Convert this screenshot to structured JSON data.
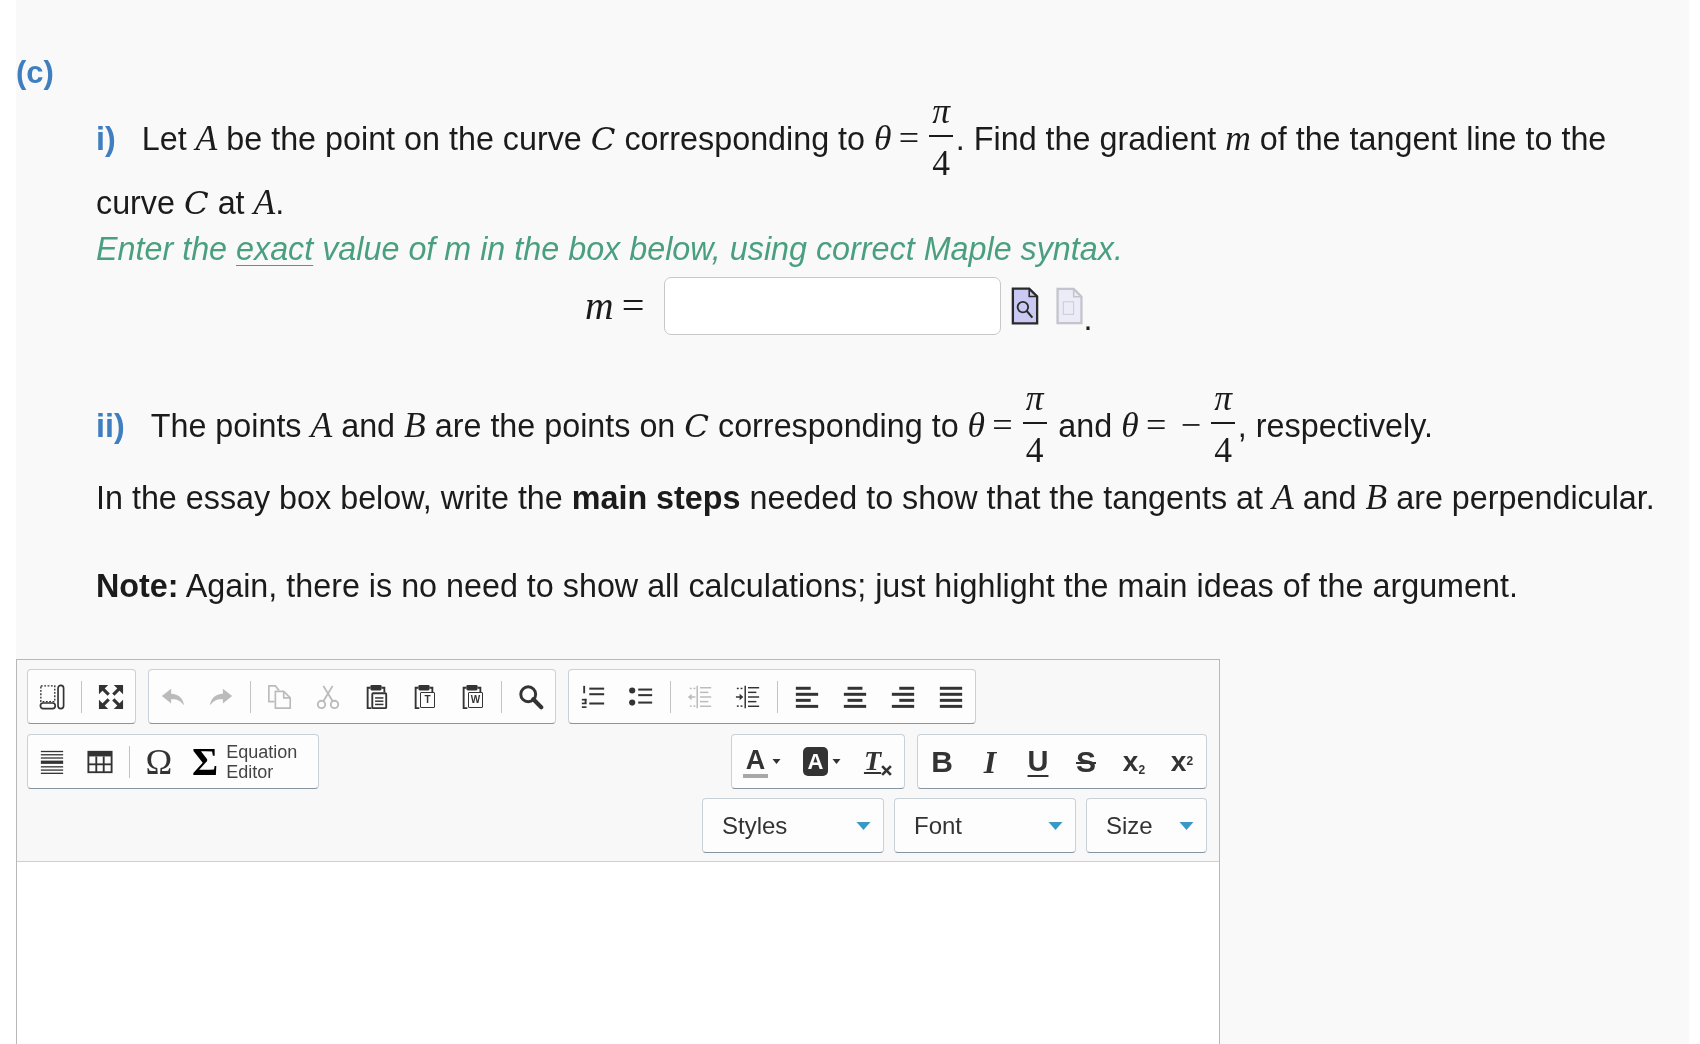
{
  "part": {
    "label": "(c)"
  },
  "questions": [
    {
      "label": "i)",
      "prompt": [
        {
          "kind": "text",
          "text": "Let "
        },
        {
          "kind": "var",
          "text": "A"
        },
        {
          "kind": "text",
          "text": " be the point on the curve "
        },
        {
          "kind": "script",
          "text": "C"
        },
        {
          "kind": "text",
          "text": " corresponding to "
        },
        {
          "kind": "var",
          "text": "θ"
        },
        {
          "kind": "op",
          "text": "="
        },
        {
          "kind": "frac",
          "num": "π",
          "den": "4"
        },
        {
          "kind": "text",
          "text": ". Find the gradient "
        },
        {
          "kind": "var",
          "text": "m"
        },
        {
          "kind": "text",
          "text": " of the tangent line to the curve "
        },
        {
          "kind": "script",
          "text": "C"
        },
        {
          "kind": "text",
          "text": " at "
        },
        {
          "kind": "var",
          "text": "A"
        },
        {
          "kind": "text",
          "text": "."
        }
      ],
      "instruction": [
        {
          "kind": "text",
          "text": "Enter the "
        },
        {
          "kind": "underlined",
          "text": "exact"
        },
        {
          "kind": "text",
          "text": " value of m in the box below, using correct Maple syntax."
        }
      ],
      "answer": {
        "variable": "m",
        "operator": "=",
        "tools": [
          {
            "kind": "preview",
            "disabled": false
          },
          {
            "kind": "plot",
            "disabled": true
          }
        ],
        "suffix": "."
      }
    },
    {
      "label": "ii)",
      "prompt": [
        {
          "kind": "text",
          "text": "The points "
        },
        {
          "kind": "var",
          "text": "A"
        },
        {
          "kind": "text",
          "text": " and "
        },
        {
          "kind": "var",
          "text": "B"
        },
        {
          "kind": "text",
          "text": " are the points on "
        },
        {
          "kind": "script",
          "text": "C"
        },
        {
          "kind": "text",
          "text": " corresponding to "
        },
        {
          "kind": "var",
          "text": "θ"
        },
        {
          "kind": "op",
          "text": "="
        },
        {
          "kind": "frac",
          "num": "π",
          "den": "4"
        },
        {
          "kind": "text",
          "text": " and "
        },
        {
          "kind": "var",
          "text": "θ"
        },
        {
          "kind": "op",
          "text": "="
        },
        {
          "kind": "op",
          "text": "−"
        },
        {
          "kind": "frac",
          "num": "π",
          "den": "4"
        },
        {
          "kind": "text",
          "text": ", respectively."
        }
      ],
      "details": [
        [
          {
            "kind": "text",
            "text": "In the essay box below, write the **main steps** needed to show that the tangents at "
          },
          {
            "kind": "var",
            "text": "A"
          },
          {
            "kind": "text",
            "text": " and "
          },
          {
            "kind": "var",
            "text": "B"
          },
          {
            "kind": "text",
            "text": " are perpendicular."
          }
        ]
      ],
      "note": "**Note:** Again, there is no need to show all calculations; just highlight the main ideas of the argument."
    }
  ],
  "editor": {
    "toolbar": [
      {
        "groups": [
          {
            "sections": [
              {
                "buttons": [
                  {
                    "kind": "blocks",
                    "disabled": false
                  }
                ]
              },
              {
                "buttons": [
                  {
                    "kind": "maximize",
                    "disabled": false
                  }
                ]
              }
            ]
          },
          {
            "sections": [
              {
                "buttons": [
                  {
                    "kind": "undo",
                    "disabled": true
                  },
                  {
                    "kind": "redo",
                    "disabled": true
                  }
                ]
              },
              {
                "buttons": [
                  {
                    "kind": "copy",
                    "disabled": true
                  },
                  {
                    "kind": "cut",
                    "disabled": true
                  },
                  {
                    "kind": "paste",
                    "disabled": false
                  },
                  {
                    "kind": "pastetext",
                    "glyph": "T",
                    "disabled": false
                  },
                  {
                    "kind": "pasteword",
                    "glyph": "W",
                    "disabled": false
                  }
                ]
              },
              {
                "buttons": [
                  {
                    "kind": "find",
                    "disabled": false
                  }
                ]
              }
            ]
          },
          {
            "sections": [
              {
                "buttons": [
                  {
                    "kind": "numbered",
                    "disabled": false
                  },
                  {
                    "kind": "bulleted",
                    "disabled": false
                  }
                ]
              },
              {
                "buttons": [
                  {
                    "kind": "outdent",
                    "disabled": true
                  },
                  {
                    "kind": "indent",
                    "disabled": false
                  }
                ]
              },
              {
                "buttons": [
                  {
                    "kind": "alignleft",
                    "disabled": false
                  },
                  {
                    "kind": "aligncenter",
                    "disabled": false
                  },
                  {
                    "kind": "alignright",
                    "disabled": false
                  },
                  {
                    "kind": "justify",
                    "disabled": false
                  }
                ]
              }
            ]
          }
        ]
      },
      {
        "groups": [
          {
            "sections": [
              {
                "buttons": [
                  {
                    "kind": "rule",
                    "disabled": false
                  },
                  {
                    "kind": "table",
                    "disabled": false
                  }
                ]
              },
              {
                "buttons": [
                  {
                    "kind": "symbol",
                    "glyph": "Ω",
                    "disabled": false
                  },
                  {
                    "kind": "equation",
                    "glyph": "Σ",
                    "label": "Equation Editor",
                    "disabled": false
                  }
                ]
              }
            ]
          },
          {
            "sections": [
              {
                "buttons": [
                  {
                    "kind": "textcolor",
                    "glyph": "A",
                    "disabled": false
                  },
                  {
                    "kind": "bgcolor",
                    "glyph": "A",
                    "disabled": false
                  },
                  {
                    "kind": "removeformat",
                    "glyph": "T",
                    "disabled": false
                  }
                ]
              }
            ]
          },
          {
            "sections": [
              {
                "buttons": [
                  {
                    "kind": "bold",
                    "glyph": "B",
                    "disabled": false
                  },
                  {
                    "kind": "italic",
                    "glyph": "I",
                    "disabled": false
                  },
                  {
                    "kind": "underline",
                    "glyph": "U",
                    "disabled": false
                  },
                  {
                    "kind": "strike",
                    "glyph": "S",
                    "disabled": false
                  },
                  {
                    "kind": "subscript",
                    "glyph": "x$_{2}$",
                    "disabled": false
                  },
                  {
                    "kind": "superscript",
                    "glyph": "x$^{2}$",
                    "disabled": false
                  }
                ]
              }
            ]
          }
        ]
      }
    ],
    "combos": [
      {
        "label": "Styles"
      },
      {
        "label": "Font"
      },
      {
        "label": "Size"
      }
    ]
  }
}
